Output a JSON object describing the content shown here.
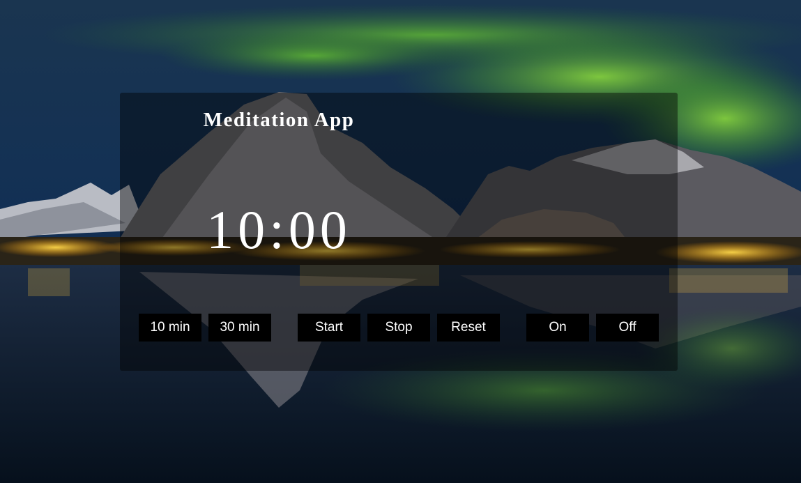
{
  "app": {
    "title": "Meditation App",
    "timer_display": "10:00"
  },
  "duration_buttons": [
    {
      "label": "10 min"
    },
    {
      "label": "30 min"
    }
  ],
  "control_buttons": [
    {
      "label": "Start"
    },
    {
      "label": "Stop"
    },
    {
      "label": "Reset"
    }
  ],
  "sound_buttons": [
    {
      "label": "On"
    },
    {
      "label": "Off"
    }
  ],
  "colors": {
    "panel_overlay": "#000000",
    "button_bg": "#000000",
    "text": "#ffffff",
    "aurora": "#7ed321",
    "sky": "#10284a"
  },
  "background": {
    "description_icon": "aurora-mountain-lake-image"
  }
}
